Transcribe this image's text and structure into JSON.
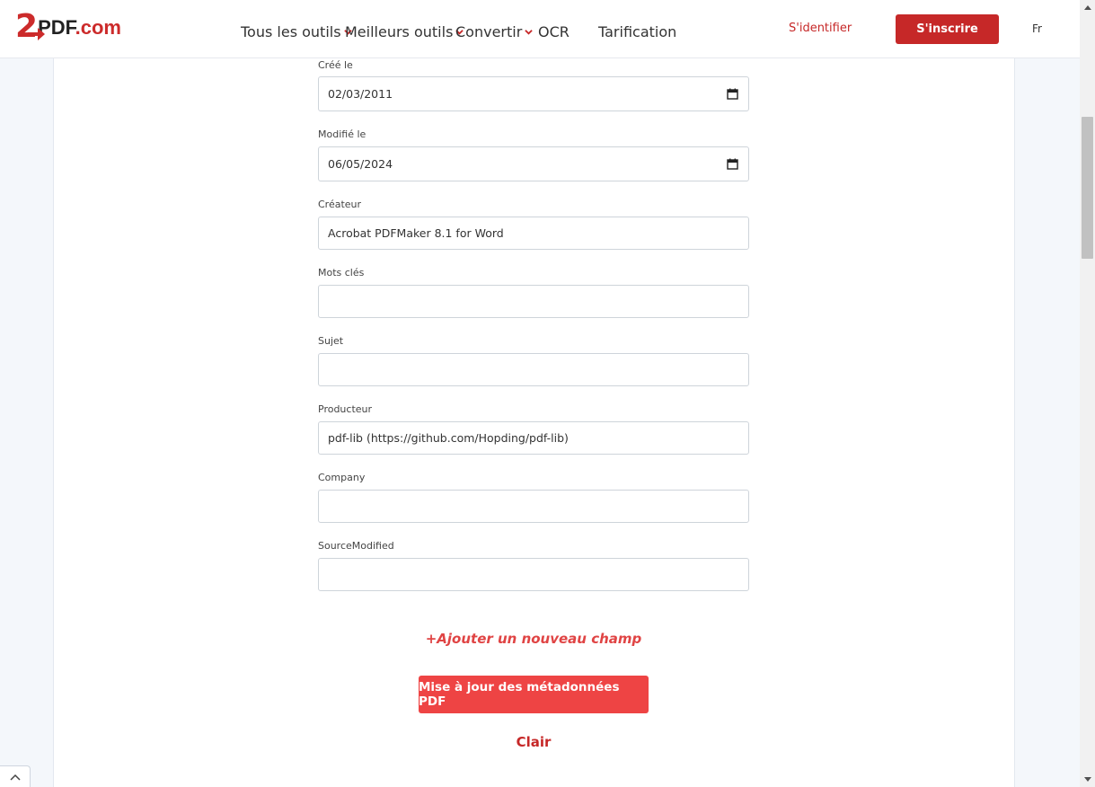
{
  "brand": {
    "logo_two": "2",
    "logo_pdf": "PDF",
    "logo_domain": ".com"
  },
  "nav": {
    "items": [
      {
        "label": "Tous les outils",
        "has_dropdown": true
      },
      {
        "label": "Meilleurs outils",
        "has_dropdown": true
      },
      {
        "label": "Convertir",
        "has_dropdown": true
      },
      {
        "label": "OCR",
        "has_dropdown": false
      },
      {
        "label": "Tarification",
        "has_dropdown": false
      }
    ],
    "login": "S'identifier",
    "signup": "S'inscrire",
    "language": "Fr"
  },
  "form": {
    "fields": [
      {
        "label": "Créé le",
        "value": "02/03/2011",
        "type": "date"
      },
      {
        "label": "Modifié le",
        "value": "06/05/2024",
        "type": "date"
      },
      {
        "label": "Créateur",
        "value": "Acrobat PDFMaker 8.1 for Word",
        "type": "text"
      },
      {
        "label": "Mots clés",
        "value": "",
        "type": "text"
      },
      {
        "label": "Sujet",
        "value": "",
        "type": "text"
      },
      {
        "label": "Producteur",
        "value": "pdf-lib (https://github.com/Hopding/pdf-lib)",
        "type": "text"
      },
      {
        "label": "Company",
        "value": "",
        "type": "text"
      },
      {
        "label": "SourceModified",
        "value": "",
        "type": "text"
      }
    ],
    "add_field": "+Ajouter un nouveau champ",
    "submit": "Mise à jour des métadonnées PDF",
    "clear": "Clair"
  },
  "colors": {
    "brand_red": "#c62828",
    "button_red": "#ee4444",
    "link_red": "#e04444"
  }
}
